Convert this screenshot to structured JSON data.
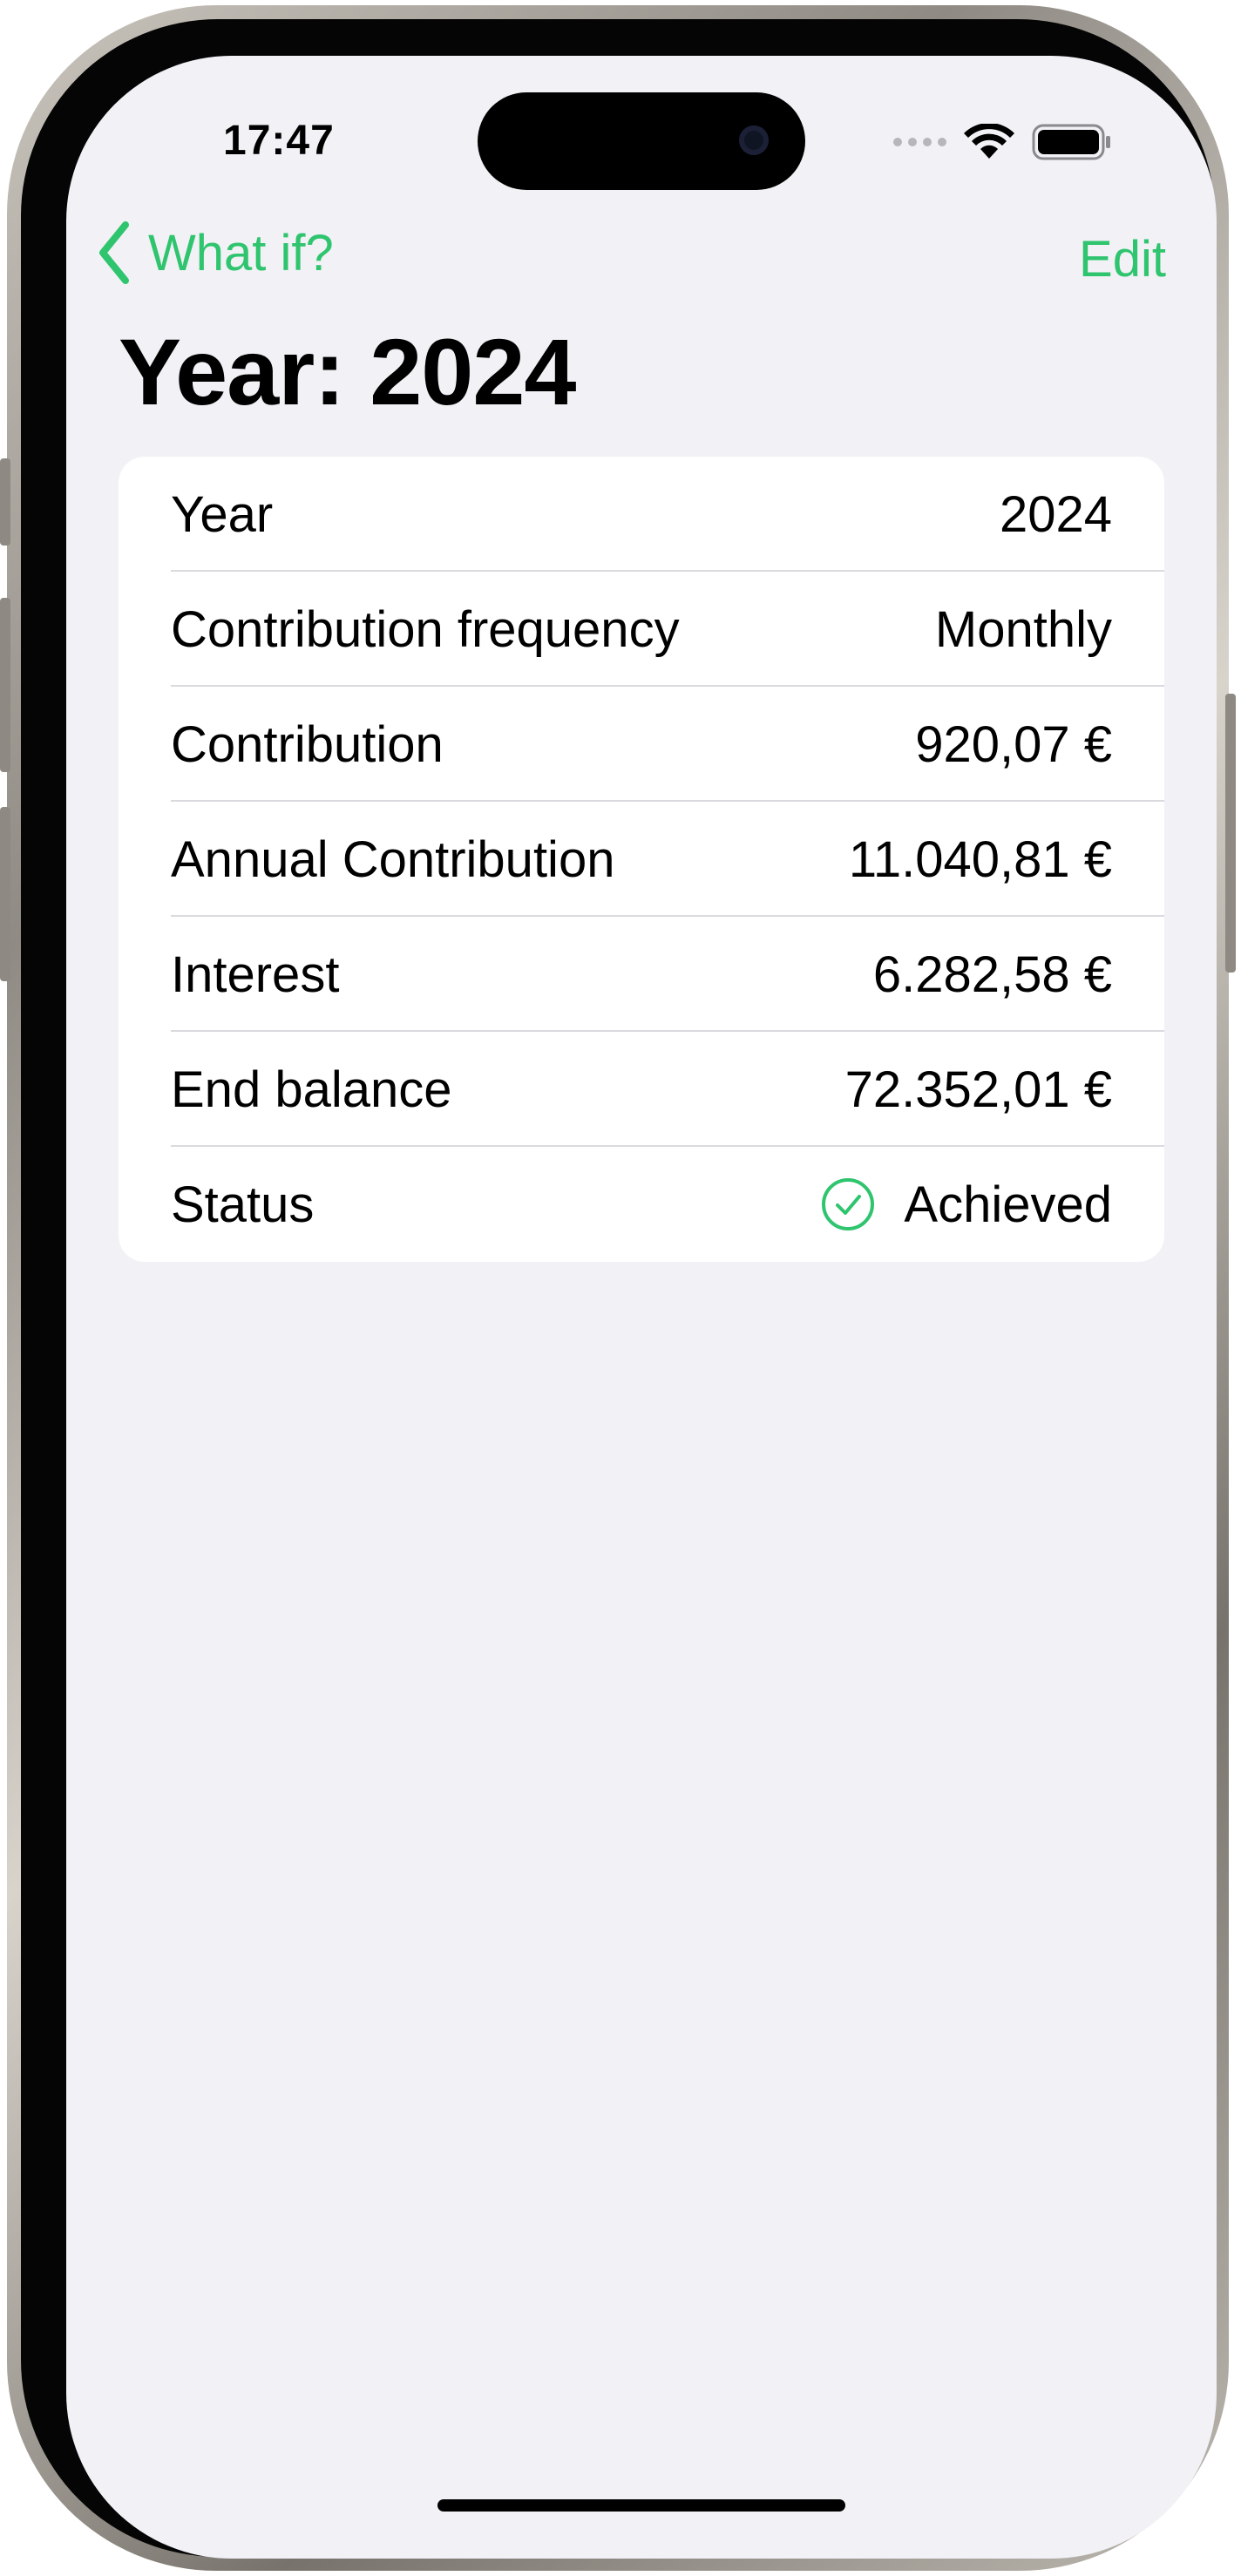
{
  "status_bar": {
    "time": "17:47"
  },
  "nav": {
    "back_label": "What if?",
    "edit_label": "Edit"
  },
  "page": {
    "title": "Year: 2024"
  },
  "details": [
    {
      "label": "Year",
      "value": "2024"
    },
    {
      "label": "Contribution frequency",
      "value": "Monthly"
    },
    {
      "label": "Contribution",
      "value": "920,07 €"
    },
    {
      "label": "Annual Contribution",
      "value": "11.040,81 €"
    },
    {
      "label": "Interest",
      "value": "6.282,58 €"
    },
    {
      "label": "End balance",
      "value": "72.352,01 €"
    },
    {
      "label": "Status",
      "value": "Achieved",
      "icon": "checkmark-circle-icon"
    }
  ],
  "colors": {
    "accent": "#2fc46e",
    "background": "#f1f1f6",
    "card": "#ffffff",
    "separator": "#dadadf"
  }
}
